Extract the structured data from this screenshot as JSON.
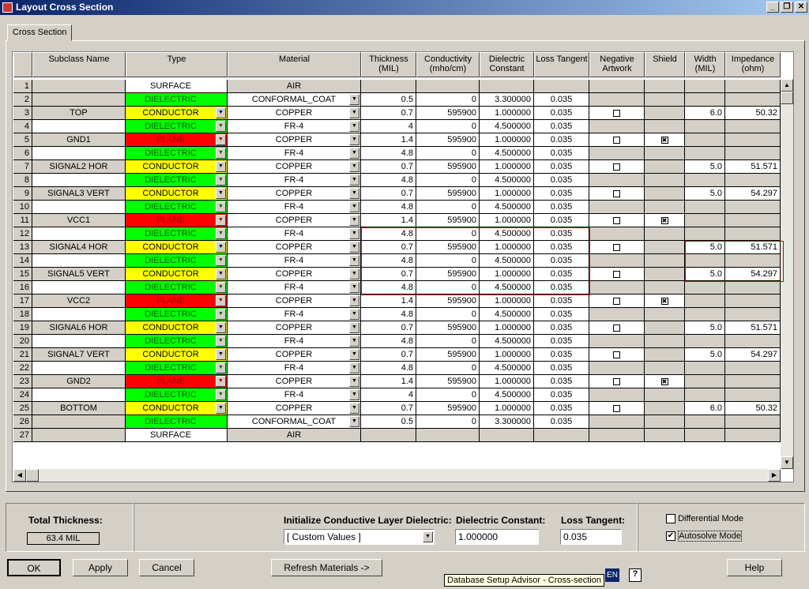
{
  "window": {
    "title": "Layout Cross Section",
    "min": "_",
    "max": "❐",
    "close": "✕"
  },
  "tab": "Cross Section",
  "columns": [
    "",
    "Subclass Name",
    "Type",
    "Material",
    "Thickness\n(MIL)",
    "Conductivity\n(mho/cm)",
    "Dielectric\nConstant",
    "Loss Tangent",
    "Negative\nArtwork",
    "Shield",
    "Width\n(MIL)",
    "Impedance\n(ohm)"
  ],
  "colors": {
    "dielectric": "#00ff00",
    "conductor": "#ffff00",
    "plane": "#ff0000",
    "surface": "#ffffff"
  },
  "rows": [
    [
      "1",
      "",
      "SURFACE",
      "AIR",
      "",
      "",
      "",
      "",
      "",
      "",
      "",
      ""
    ],
    [
      "2",
      "",
      "DIELECTRIC",
      "CONFORMAL_COAT",
      "0.5",
      "0",
      "3.300000",
      "0.035",
      "",
      "",
      "",
      ""
    ],
    [
      "3",
      "TOP",
      "CONDUCTOR",
      "COPPER",
      "0.7",
      "595900",
      "1.000000",
      "0.035",
      "off",
      "",
      "6.0",
      "50.32"
    ],
    [
      "4",
      "",
      "DIELECTRIC",
      "FR-4",
      "4",
      "0",
      "4.500000",
      "0.035",
      "",
      "",
      "",
      ""
    ],
    [
      "5",
      "GND1",
      "PLANE",
      "COPPER",
      "1.4",
      "595900",
      "1.000000",
      "0.035",
      "off",
      "on",
      "",
      ""
    ],
    [
      "6",
      "",
      "DIELECTRIC",
      "FR-4",
      "4.8",
      "0",
      "4.500000",
      "0.035",
      "",
      "",
      "",
      ""
    ],
    [
      "7",
      "SIGNAL2 HOR",
      "CONDUCTOR",
      "COPPER",
      "0.7",
      "595900",
      "1.000000",
      "0.035",
      "off",
      "",
      "5.0",
      "51.571"
    ],
    [
      "8",
      "",
      "DIELECTRIC",
      "FR-4",
      "4.8",
      "0",
      "4.500000",
      "0.035",
      "",
      "",
      "",
      ""
    ],
    [
      "9",
      "SIGNAL3 VERT",
      "CONDUCTOR",
      "COPPER",
      "0.7",
      "595900",
      "1.000000",
      "0.035",
      "off",
      "",
      "5.0",
      "54.297"
    ],
    [
      "10",
      "",
      "DIELECTRIC",
      "FR-4",
      "4.8",
      "0",
      "4.500000",
      "0.035",
      "",
      "",
      "",
      ""
    ],
    [
      "11",
      "VCC1",
      "PLANE",
      "COPPER",
      "1.4",
      "595900",
      "1.000000",
      "0.035",
      "off",
      "on",
      "",
      ""
    ],
    [
      "12",
      "",
      "DIELECTRIC",
      "FR-4",
      "4.8",
      "0",
      "4.500000",
      "0.035",
      "",
      "",
      "",
      ""
    ],
    [
      "13",
      "SIGNAL4 HOR",
      "CONDUCTOR",
      "COPPER",
      "0.7",
      "595900",
      "1.000000",
      "0.035",
      "off",
      "",
      "5.0",
      "51.571"
    ],
    [
      "14",
      "",
      "DIELECTRIC",
      "FR-4",
      "4.8",
      "0",
      "4.500000",
      "0.035",
      "",
      "",
      "",
      ""
    ],
    [
      "15",
      "SIGNAL5 VERT",
      "CONDUCTOR",
      "COPPER",
      "0.7",
      "595900",
      "1.000000",
      "0.035",
      "off",
      "",
      "5.0",
      "54.297"
    ],
    [
      "16",
      "",
      "DIELECTRIC",
      "FR-4",
      "4.8",
      "0",
      "4.500000",
      "0.035",
      "",
      "",
      "",
      ""
    ],
    [
      "17",
      "VCC2",
      "PLANE",
      "COPPER",
      "1.4",
      "595900",
      "1.000000",
      "0.035",
      "off",
      "on",
      "",
      ""
    ],
    [
      "18",
      "",
      "DIELECTRIC",
      "FR-4",
      "4.8",
      "0",
      "4.500000",
      "0.035",
      "",
      "",
      "",
      ""
    ],
    [
      "19",
      "SIGNAL6 HOR",
      "CONDUCTOR",
      "COPPER",
      "0.7",
      "595900",
      "1.000000",
      "0.035",
      "off",
      "",
      "5.0",
      "51.571"
    ],
    [
      "20",
      "",
      "DIELECTRIC",
      "FR-4",
      "4.8",
      "0",
      "4.500000",
      "0.035",
      "",
      "",
      "",
      ""
    ],
    [
      "21",
      "SIGNAL7 VERT",
      "CONDUCTOR",
      "COPPER",
      "0.7",
      "595900",
      "1.000000",
      "0.035",
      "off",
      "",
      "5.0",
      "54.297"
    ],
    [
      "22",
      "",
      "DIELECTRIC",
      "FR-4",
      "4.8",
      "0",
      "4.500000",
      "0.035",
      "",
      "",
      "",
      ""
    ],
    [
      "23",
      "GND2",
      "PLANE",
      "COPPER",
      "1.4",
      "595900",
      "1.000000",
      "0.035",
      "off",
      "on",
      "",
      ""
    ],
    [
      "24",
      "",
      "DIELECTRIC",
      "FR-4",
      "4",
      "0",
      "4.500000",
      "0.035",
      "",
      "",
      "",
      ""
    ],
    [
      "25",
      "BOTTOM",
      "CONDUCTOR",
      "COPPER",
      "0.7",
      "595900",
      "1.000000",
      "0.035",
      "off",
      "",
      "6.0",
      "50.32"
    ],
    [
      "26",
      "",
      "DIELECTRIC",
      "CONFORMAL_COAT",
      "0.5",
      "0",
      "3.300000",
      "0.035",
      "",
      "",
      "",
      ""
    ],
    [
      "27",
      "",
      "SURFACE",
      "AIR",
      "",
      "",
      "",
      "",
      "",
      "",
      "",
      ""
    ]
  ],
  "footer": {
    "total_thickness_label": "Total Thickness:",
    "total_thickness": "63.4 MIL",
    "init_label": "Initialize Conductive Layer Dielectric:",
    "init_value": "[  Custom Values  ]",
    "dk_label": "Dielectric Constant:",
    "dk_value": "1.000000",
    "lt_label": "Loss Tangent:",
    "lt_value": "0.035",
    "diff_mode": "Differential Mode",
    "autosolve": "Autosolve Mode"
  },
  "buttons": {
    "ok": "OK",
    "apply": "Apply",
    "cancel": "Cancel",
    "refresh": "Refresh Materials ->",
    "help": "Help"
  },
  "tooltip": "Database Setup Advisor - Cross-section",
  "tray": {
    "lang": "EN",
    "help": "?"
  }
}
